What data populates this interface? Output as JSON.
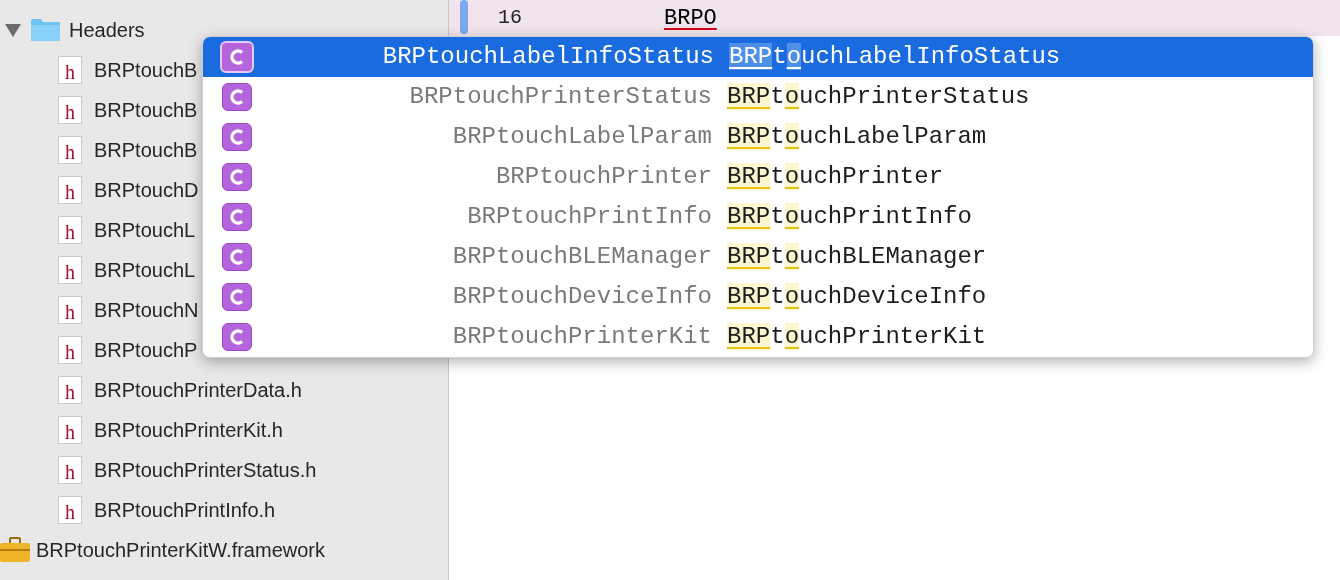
{
  "navigator": {
    "group": {
      "label": "Headers",
      "expanded": true
    },
    "files": [
      {
        "icon": "h",
        "name": "BRPtouchB"
      },
      {
        "icon": "h",
        "name": "BRPtouchB"
      },
      {
        "icon": "h",
        "name": "BRPtouchB"
      },
      {
        "icon": "h",
        "name": "BRPtouchD"
      },
      {
        "icon": "h",
        "name": "BRPtouchL"
      },
      {
        "icon": "h",
        "name": "BRPtouchL"
      },
      {
        "icon": "h",
        "name": "BRPtouchN"
      },
      {
        "icon": "h",
        "name": "BRPtouchP"
      },
      {
        "icon": "h",
        "name": "BRPtouchPrinterData.h"
      },
      {
        "icon": "h",
        "name": "BRPtouchPrinterKit.h"
      },
      {
        "icon": "h",
        "name": "BRPtouchPrinterStatus.h"
      },
      {
        "icon": "h",
        "name": "BRPtouchPrintInfo.h"
      }
    ],
    "framework": {
      "name": "BRPtouchPrinterKitW.framework"
    }
  },
  "editor": {
    "line_number": "16",
    "typed": "BRPO"
  },
  "completions": [
    {
      "type_name": "BRPtouchLabelInfoStatus",
      "completion": [
        {
          "text": "BRP",
          "matched": true
        },
        {
          "text": "t",
          "matched": false
        },
        {
          "text": "o",
          "matched": true
        },
        {
          "text": "uchLabelInfoStatus",
          "matched": false
        }
      ],
      "selected": true
    },
    {
      "type_name": "BRPtouchPrinterStatus",
      "completion": [
        {
          "text": "BRP",
          "matched": true
        },
        {
          "text": "t",
          "matched": false
        },
        {
          "text": "o",
          "matched": true
        },
        {
          "text": "uchPrinterStatus",
          "matched": false
        }
      ],
      "selected": false
    },
    {
      "type_name": "BRPtouchLabelParam",
      "completion": [
        {
          "text": "BRP",
          "matched": true
        },
        {
          "text": "t",
          "matched": false
        },
        {
          "text": "o",
          "matched": true
        },
        {
          "text": "uchLabelParam",
          "matched": false
        }
      ],
      "selected": false
    },
    {
      "type_name": "BRPtouchPrinter",
      "completion": [
        {
          "text": "BRP",
          "matched": true
        },
        {
          "text": "t",
          "matched": false
        },
        {
          "text": "o",
          "matched": true
        },
        {
          "text": "uchPrinter",
          "matched": false
        }
      ],
      "selected": false
    },
    {
      "type_name": "BRPtouchPrintInfo",
      "completion": [
        {
          "text": "BRP",
          "matched": true
        },
        {
          "text": "t",
          "matched": false
        },
        {
          "text": "o",
          "matched": true
        },
        {
          "text": "uchPrintInfo",
          "matched": false
        }
      ],
      "selected": false
    },
    {
      "type_name": "BRPtouchBLEManager",
      "completion": [
        {
          "text": "BRP",
          "matched": true
        },
        {
          "text": "t",
          "matched": false
        },
        {
          "text": "o",
          "matched": true
        },
        {
          "text": "uchBLEManager",
          "matched": false
        }
      ],
      "selected": false
    },
    {
      "type_name": "BRPtouchDeviceInfo",
      "completion": [
        {
          "text": "BRP",
          "matched": true
        },
        {
          "text": "t",
          "matched": false
        },
        {
          "text": "o",
          "matched": true
        },
        {
          "text": "uchDeviceInfo",
          "matched": false
        }
      ],
      "selected": false
    },
    {
      "type_name": "BRPtouchPrinterKit",
      "completion": [
        {
          "text": "BRP",
          "matched": true
        },
        {
          "text": "t",
          "matched": false
        },
        {
          "text": "o",
          "matched": true
        },
        {
          "text": "uchPrinterKit",
          "matched": false
        }
      ],
      "selected": false
    }
  ]
}
